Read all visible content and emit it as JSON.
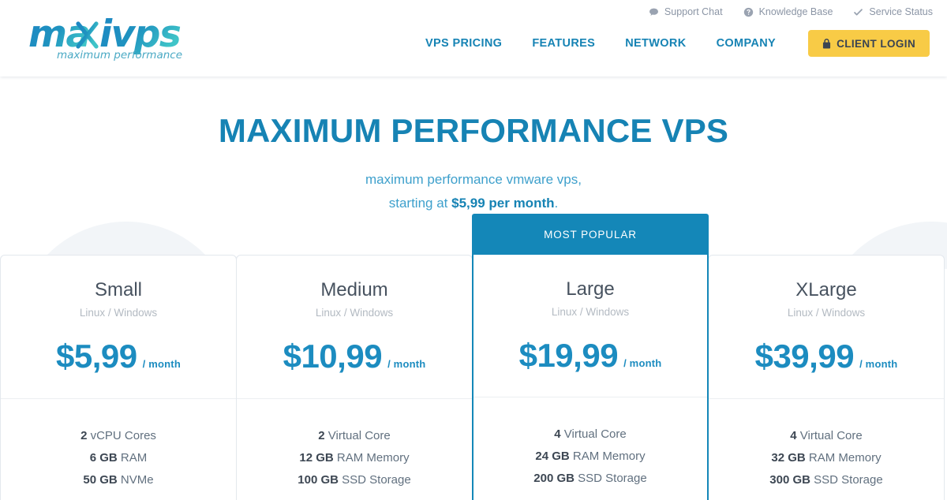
{
  "header": {
    "logo": {
      "name": "maxivps",
      "tagline": "maximum performance"
    },
    "utility_links": [
      {
        "label": "Support Chat",
        "icon": "chat-bubble-icon"
      },
      {
        "label": "Knowledge Base",
        "icon": "question-circle-icon"
      },
      {
        "label": "Service Status",
        "icon": "check-icon"
      }
    ],
    "nav_items": [
      {
        "label": "VPS PRICING"
      },
      {
        "label": "FEATURES"
      },
      {
        "label": "NETWORK"
      },
      {
        "label": "COMPANY"
      }
    ],
    "login_button": {
      "label": "CLIENT LOGIN",
      "icon": "lock-icon",
      "background": "#f8cb46",
      "text_color": "#3b4452"
    }
  },
  "hero": {
    "title": "MAXIMUM PERFORMANCE VPS",
    "subtitle_line1": "maximum performance vmware vps,",
    "subtitle_line2_prefix": "starting at ",
    "subtitle_line2_bold": "$5,99 per month",
    "subtitle_line2_suffix": "."
  },
  "pricing": {
    "popular_badge": "MOST POPULAR",
    "accent_color": "#1487b8",
    "price_color": "#1c8cc0",
    "plans": [
      {
        "name": "Small",
        "os": "Linux / Windows",
        "price": "$5,99",
        "period": "/ month",
        "popular": false,
        "specs": [
          {
            "value": "2",
            "label": " vCPU Cores"
          },
          {
            "value": "6 GB",
            "label": " RAM"
          },
          {
            "value": "50 GB",
            "label": " NVMe"
          }
        ]
      },
      {
        "name": "Medium",
        "os": "Linux / Windows",
        "price": "$10,99",
        "period": "/ month",
        "popular": false,
        "specs": [
          {
            "value": "2",
            "label": " Virtual Core"
          },
          {
            "value": "12 GB",
            "label": " RAM Memory"
          },
          {
            "value": "100 GB",
            "label": " SSD Storage"
          }
        ]
      },
      {
        "name": "Large",
        "os": "Linux / Windows",
        "price": "$19,99",
        "period": "/ month",
        "popular": true,
        "specs": [
          {
            "value": "4",
            "label": " Virtual Core"
          },
          {
            "value": "24 GB",
            "label": " RAM Memory"
          },
          {
            "value": "200 GB",
            "label": " SSD Storage"
          }
        ]
      },
      {
        "name": "XLarge",
        "os": "Linux / Windows",
        "price": "$39,99",
        "period": "/ month",
        "popular": false,
        "specs": [
          {
            "value": "4",
            "label": " Virtual Core"
          },
          {
            "value": "32 GB",
            "label": " RAM Memory"
          },
          {
            "value": "300 GB",
            "label": " SSD Storage"
          }
        ]
      }
    ]
  }
}
